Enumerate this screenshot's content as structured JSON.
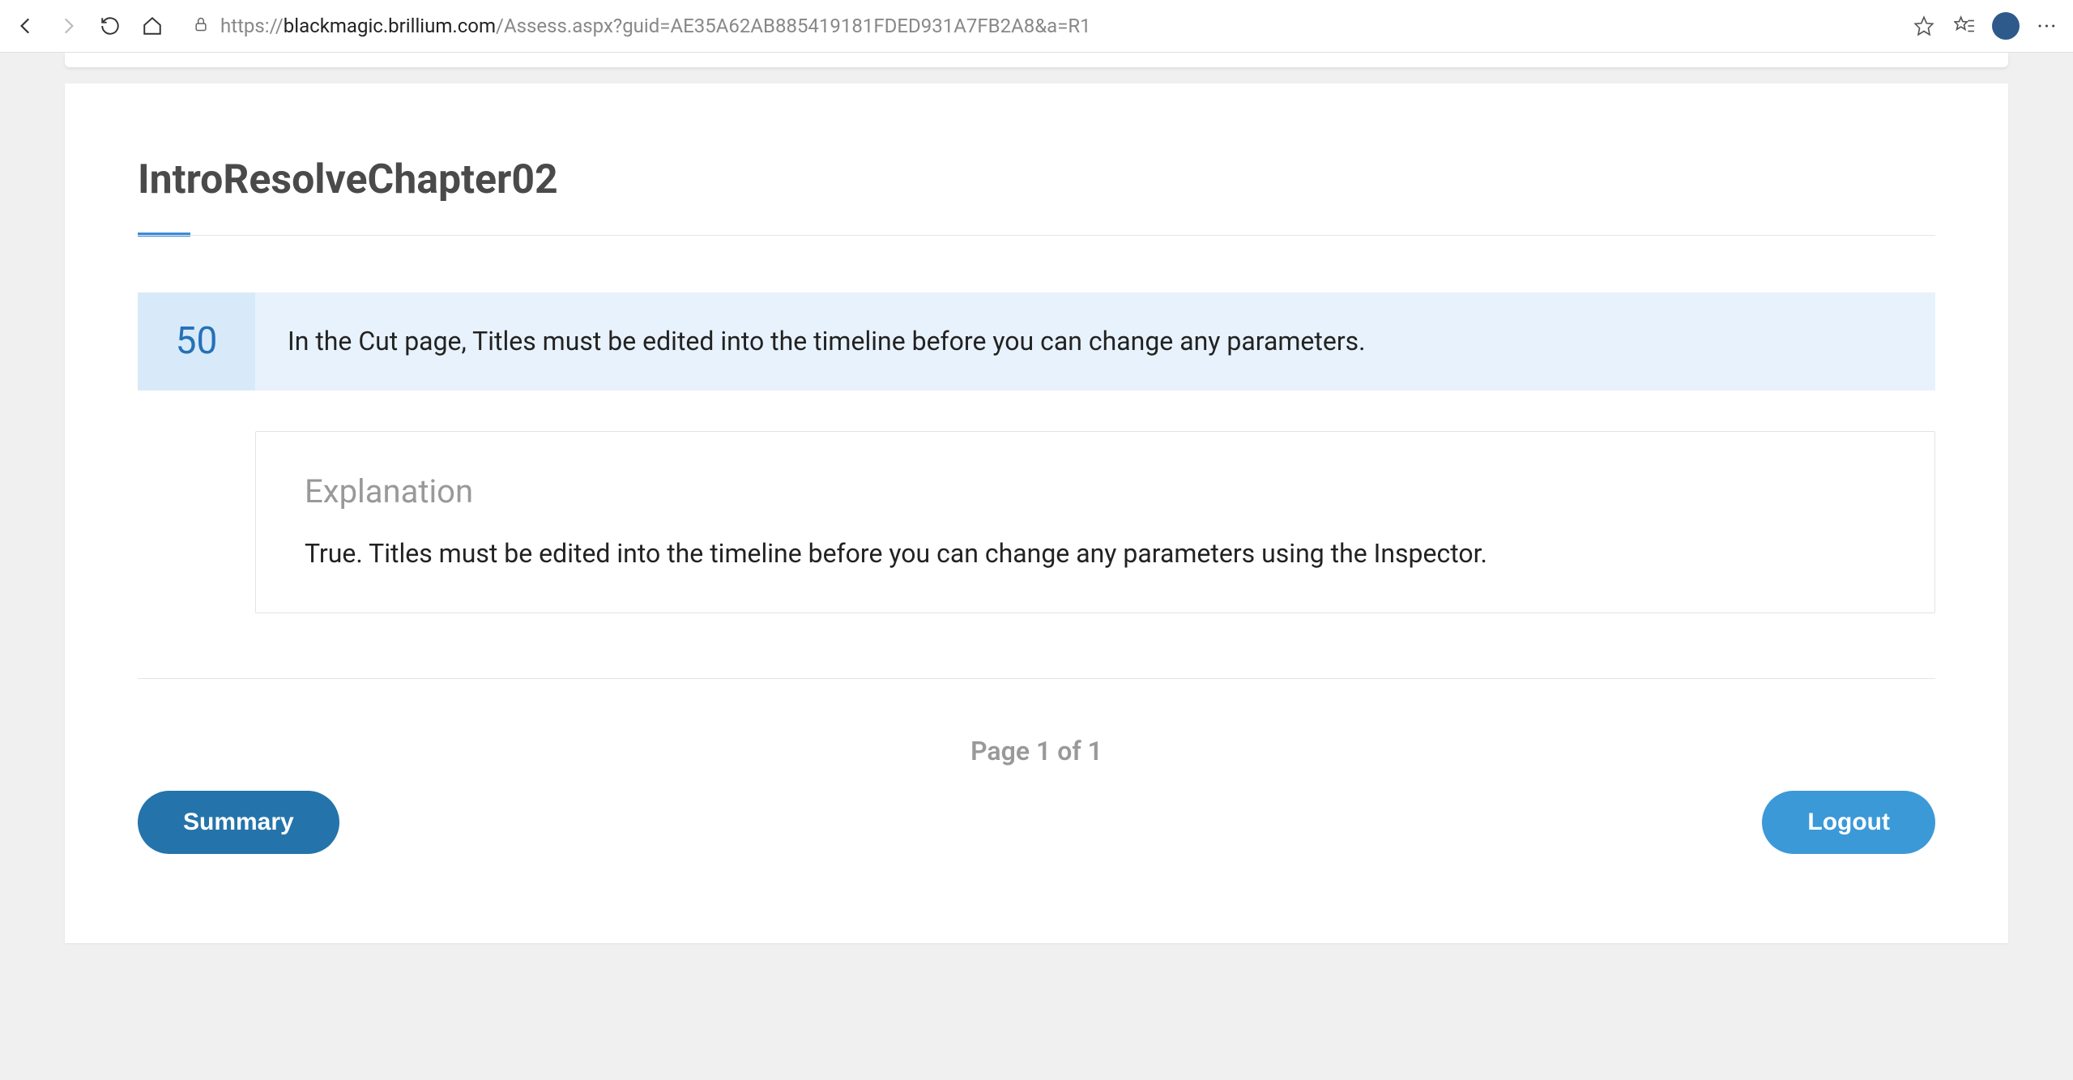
{
  "browser": {
    "url_host": "blackmagic.brillium.com",
    "url_protocol": "https://",
    "url_path": "/Assess.aspx?guid=AE35A62AB885419181FDED931A7FB2A8&a=R1"
  },
  "page": {
    "title": "IntroResolveChapter02",
    "question": {
      "number": "50",
      "text": "In the Cut page, Titles must be edited into the timeline before you can change any parameters."
    },
    "explanation": {
      "heading": "Explanation",
      "text": "True. Titles must be edited into the timeline before you can change any parameters using the Inspector."
    },
    "pagination": "Page 1 of 1",
    "buttons": {
      "summary": "Summary",
      "logout": "Logout"
    }
  }
}
